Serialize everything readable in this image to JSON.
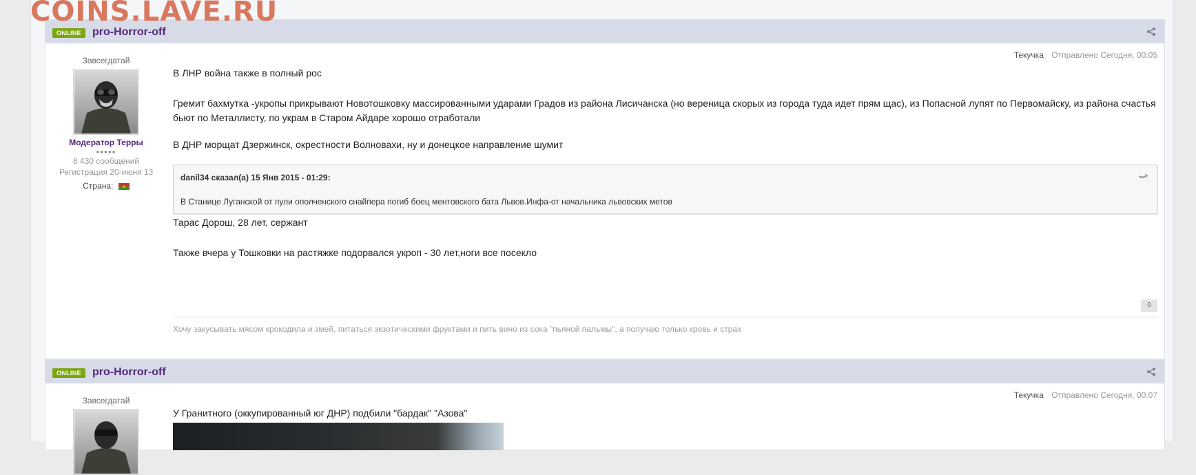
{
  "watermark": "COINS.LAVE.RU",
  "posts": [
    {
      "online_label": "ONLINE",
      "author": "pro-Horror-off",
      "user_title": "Завсегдатай",
      "group": "Модератор Терры",
      "pips": "●●●●●",
      "post_count": "8 430 сообщений",
      "registered": "Регистрация 20-июня 13",
      "country_label": "Страна:",
      "mood": "Текучка",
      "posted": "Отправлено Сегодня, 00:05",
      "paragraphs": [
        "В ЛНР война также в полный рос",
        "Гремит бахмутка -укропы прикрывают Новотошковку массированными ударами Градов из района Лисичанска (но вереница скорых из города туда идет прям щас), из Попасной лупят по Первомайску, из района счастья бьют по Металлисту, по украм в Старом Айдаре хорошо отработали",
        "В ДНР морщат Дзержинск, окрестности Волновахи, ну и донецкое направление шумит"
      ],
      "quote": {
        "header": "danil34 сказал(а) 15 Янв 2015 - 01:29:",
        "body": "В Станице Луганской от пули ополченского снайпера погиб боец ментовского бата Львов.Инфа-от начальника львовских метов"
      },
      "after_quote": [
        "Тарас Дорош, 28 лет, сержант",
        "Также вчера у Тошковки на растяжке подорвался укроп - 30 лет,ноги все посекло"
      ],
      "reputation": "0",
      "signature": "Хочу закусывать мясом крокодила и змей, питаться экзотическими фруктами и пить вино из сока \"пьяной пальмы\", а получаю только кровь и страх"
    },
    {
      "online_label": "ONLINE",
      "author": "pro-Horror-off",
      "user_title": "Завсегдатай",
      "mood": "Текучка",
      "posted": "Отправлено Сегодня, 00:07",
      "paragraphs": [
        "У Гранитного (оккупированный юг ДНР) подбили \"бардак\" \"Азова\""
      ]
    }
  ]
}
